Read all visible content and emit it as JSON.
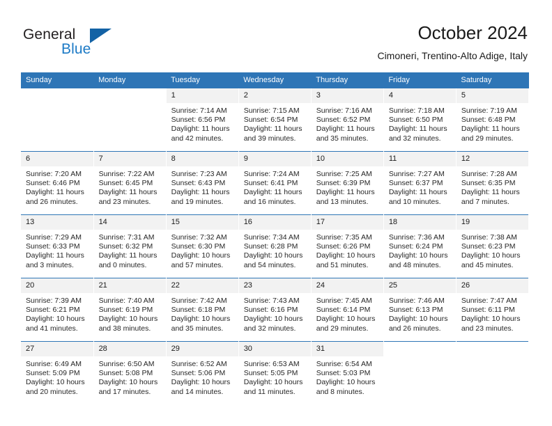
{
  "brand": {
    "name_part1": "General",
    "name_part2": "Blue",
    "accent_color": "#1c7ac6",
    "triangle_color": "#1362a5"
  },
  "header": {
    "month_title": "October 2024",
    "location": "Cimoneri, Trentino-Alto Adige, Italy",
    "header_bg_color": "#2e75b6",
    "daynum_bg_color": "#f2f2f2"
  },
  "weekday_headers": [
    "Sunday",
    "Monday",
    "Tuesday",
    "Wednesday",
    "Thursday",
    "Friday",
    "Saturday"
  ],
  "weeks": [
    [
      {
        "day": "",
        "sunrise": "",
        "sunset": "",
        "daylight1": "",
        "daylight2": "",
        "blank": true
      },
      {
        "day": "",
        "sunrise": "",
        "sunset": "",
        "daylight1": "",
        "daylight2": "",
        "blank": true
      },
      {
        "day": "1",
        "sunrise": "Sunrise: 7:14 AM",
        "sunset": "Sunset: 6:56 PM",
        "daylight1": "Daylight: 11 hours",
        "daylight2": "and 42 minutes."
      },
      {
        "day": "2",
        "sunrise": "Sunrise: 7:15 AM",
        "sunset": "Sunset: 6:54 PM",
        "daylight1": "Daylight: 11 hours",
        "daylight2": "and 39 minutes."
      },
      {
        "day": "3",
        "sunrise": "Sunrise: 7:16 AM",
        "sunset": "Sunset: 6:52 PM",
        "daylight1": "Daylight: 11 hours",
        "daylight2": "and 35 minutes."
      },
      {
        "day": "4",
        "sunrise": "Sunrise: 7:18 AM",
        "sunset": "Sunset: 6:50 PM",
        "daylight1": "Daylight: 11 hours",
        "daylight2": "and 32 minutes."
      },
      {
        "day": "5",
        "sunrise": "Sunrise: 7:19 AM",
        "sunset": "Sunset: 6:48 PM",
        "daylight1": "Daylight: 11 hours",
        "daylight2": "and 29 minutes."
      }
    ],
    [
      {
        "day": "6",
        "sunrise": "Sunrise: 7:20 AM",
        "sunset": "Sunset: 6:46 PM",
        "daylight1": "Daylight: 11 hours",
        "daylight2": "and 26 minutes."
      },
      {
        "day": "7",
        "sunrise": "Sunrise: 7:22 AM",
        "sunset": "Sunset: 6:45 PM",
        "daylight1": "Daylight: 11 hours",
        "daylight2": "and 23 minutes."
      },
      {
        "day": "8",
        "sunrise": "Sunrise: 7:23 AM",
        "sunset": "Sunset: 6:43 PM",
        "daylight1": "Daylight: 11 hours",
        "daylight2": "and 19 minutes."
      },
      {
        "day": "9",
        "sunrise": "Sunrise: 7:24 AM",
        "sunset": "Sunset: 6:41 PM",
        "daylight1": "Daylight: 11 hours",
        "daylight2": "and 16 minutes."
      },
      {
        "day": "10",
        "sunrise": "Sunrise: 7:25 AM",
        "sunset": "Sunset: 6:39 PM",
        "daylight1": "Daylight: 11 hours",
        "daylight2": "and 13 minutes."
      },
      {
        "day": "11",
        "sunrise": "Sunrise: 7:27 AM",
        "sunset": "Sunset: 6:37 PM",
        "daylight1": "Daylight: 11 hours",
        "daylight2": "and 10 minutes."
      },
      {
        "day": "12",
        "sunrise": "Sunrise: 7:28 AM",
        "sunset": "Sunset: 6:35 PM",
        "daylight1": "Daylight: 11 hours",
        "daylight2": "and 7 minutes."
      }
    ],
    [
      {
        "day": "13",
        "sunrise": "Sunrise: 7:29 AM",
        "sunset": "Sunset: 6:33 PM",
        "daylight1": "Daylight: 11 hours",
        "daylight2": "and 3 minutes."
      },
      {
        "day": "14",
        "sunrise": "Sunrise: 7:31 AM",
        "sunset": "Sunset: 6:32 PM",
        "daylight1": "Daylight: 11 hours",
        "daylight2": "and 0 minutes."
      },
      {
        "day": "15",
        "sunrise": "Sunrise: 7:32 AM",
        "sunset": "Sunset: 6:30 PM",
        "daylight1": "Daylight: 10 hours",
        "daylight2": "and 57 minutes."
      },
      {
        "day": "16",
        "sunrise": "Sunrise: 7:34 AM",
        "sunset": "Sunset: 6:28 PM",
        "daylight1": "Daylight: 10 hours",
        "daylight2": "and 54 minutes."
      },
      {
        "day": "17",
        "sunrise": "Sunrise: 7:35 AM",
        "sunset": "Sunset: 6:26 PM",
        "daylight1": "Daylight: 10 hours",
        "daylight2": "and 51 minutes."
      },
      {
        "day": "18",
        "sunrise": "Sunrise: 7:36 AM",
        "sunset": "Sunset: 6:24 PM",
        "daylight1": "Daylight: 10 hours",
        "daylight2": "and 48 minutes."
      },
      {
        "day": "19",
        "sunrise": "Sunrise: 7:38 AM",
        "sunset": "Sunset: 6:23 PM",
        "daylight1": "Daylight: 10 hours",
        "daylight2": "and 45 minutes."
      }
    ],
    [
      {
        "day": "20",
        "sunrise": "Sunrise: 7:39 AM",
        "sunset": "Sunset: 6:21 PM",
        "daylight1": "Daylight: 10 hours",
        "daylight2": "and 41 minutes."
      },
      {
        "day": "21",
        "sunrise": "Sunrise: 7:40 AM",
        "sunset": "Sunset: 6:19 PM",
        "daylight1": "Daylight: 10 hours",
        "daylight2": "and 38 minutes."
      },
      {
        "day": "22",
        "sunrise": "Sunrise: 7:42 AM",
        "sunset": "Sunset: 6:18 PM",
        "daylight1": "Daylight: 10 hours",
        "daylight2": "and 35 minutes."
      },
      {
        "day": "23",
        "sunrise": "Sunrise: 7:43 AM",
        "sunset": "Sunset: 6:16 PM",
        "daylight1": "Daylight: 10 hours",
        "daylight2": "and 32 minutes."
      },
      {
        "day": "24",
        "sunrise": "Sunrise: 7:45 AM",
        "sunset": "Sunset: 6:14 PM",
        "daylight1": "Daylight: 10 hours",
        "daylight2": "and 29 minutes."
      },
      {
        "day": "25",
        "sunrise": "Sunrise: 7:46 AM",
        "sunset": "Sunset: 6:13 PM",
        "daylight1": "Daylight: 10 hours",
        "daylight2": "and 26 minutes."
      },
      {
        "day": "26",
        "sunrise": "Sunrise: 7:47 AM",
        "sunset": "Sunset: 6:11 PM",
        "daylight1": "Daylight: 10 hours",
        "daylight2": "and 23 minutes."
      }
    ],
    [
      {
        "day": "27",
        "sunrise": "Sunrise: 6:49 AM",
        "sunset": "Sunset: 5:09 PM",
        "daylight1": "Daylight: 10 hours",
        "daylight2": "and 20 minutes."
      },
      {
        "day": "28",
        "sunrise": "Sunrise: 6:50 AM",
        "sunset": "Sunset: 5:08 PM",
        "daylight1": "Daylight: 10 hours",
        "daylight2": "and 17 minutes."
      },
      {
        "day": "29",
        "sunrise": "Sunrise: 6:52 AM",
        "sunset": "Sunset: 5:06 PM",
        "daylight1": "Daylight: 10 hours",
        "daylight2": "and 14 minutes."
      },
      {
        "day": "30",
        "sunrise": "Sunrise: 6:53 AM",
        "sunset": "Sunset: 5:05 PM",
        "daylight1": "Daylight: 10 hours",
        "daylight2": "and 11 minutes."
      },
      {
        "day": "31",
        "sunrise": "Sunrise: 6:54 AM",
        "sunset": "Sunset: 5:03 PM",
        "daylight1": "Daylight: 10 hours",
        "daylight2": "and 8 minutes."
      },
      {
        "day": "",
        "sunrise": "",
        "sunset": "",
        "daylight1": "",
        "daylight2": "",
        "blank": true
      },
      {
        "day": "",
        "sunrise": "",
        "sunset": "",
        "daylight1": "",
        "daylight2": "",
        "blank": true
      }
    ]
  ]
}
